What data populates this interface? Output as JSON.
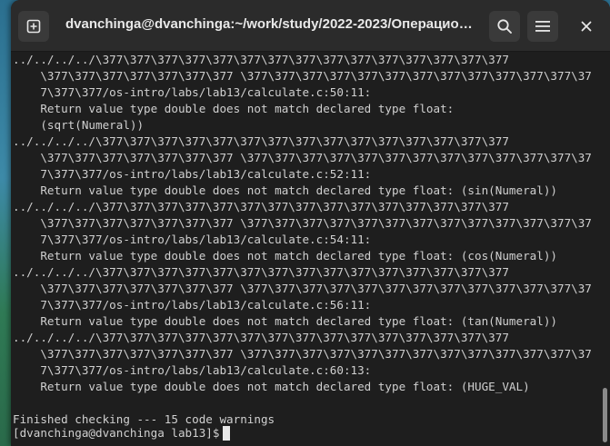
{
  "window": {
    "title": "dvanchinga@dvanchinga:~/work/study/2022-2023/Операционн…"
  },
  "header_buttons": {
    "new_tab_icon": "new-tab-plus-icon",
    "search_icon": "search-icon",
    "menu_icon": "hamburger-menu-icon",
    "close_icon": "close-icon"
  },
  "terminal": {
    "lines": [
      "../../../../\\377\\377\\377\\377\\377\\377\\377\\377\\377\\377\\377\\377\\377\\377\\377",
      "    \\377\\377\\377\\377\\377\\377\\377 \\377\\377\\377\\377\\377\\377\\377\\377\\377\\377\\377\\377\\37",
      "    7\\377\\377/os-intro/labs/lab13/calculate.c:50:11:",
      "    Return value type double does not match declared type float:",
      "    (sqrt(Numeral))",
      "../../../../\\377\\377\\377\\377\\377\\377\\377\\377\\377\\377\\377\\377\\377\\377\\377",
      "    \\377\\377\\377\\377\\377\\377\\377 \\377\\377\\377\\377\\377\\377\\377\\377\\377\\377\\377\\377\\37",
      "    7\\377\\377/os-intro/labs/lab13/calculate.c:52:11:",
      "    Return value type double does not match declared type float: (sin(Numeral))",
      "../../../../\\377\\377\\377\\377\\377\\377\\377\\377\\377\\377\\377\\377\\377\\377\\377",
      "    \\377\\377\\377\\377\\377\\377\\377 \\377\\377\\377\\377\\377\\377\\377\\377\\377\\377\\377\\377\\37",
      "    7\\377\\377/os-intro/labs/lab13/calculate.c:54:11:",
      "    Return value type double does not match declared type float: (cos(Numeral))",
      "../../../../\\377\\377\\377\\377\\377\\377\\377\\377\\377\\377\\377\\377\\377\\377\\377",
      "    \\377\\377\\377\\377\\377\\377\\377 \\377\\377\\377\\377\\377\\377\\377\\377\\377\\377\\377\\377\\37",
      "    7\\377\\377/os-intro/labs/lab13/calculate.c:56:11:",
      "    Return value type double does not match declared type float: (tan(Numeral))",
      "../../../../\\377\\377\\377\\377\\377\\377\\377\\377\\377\\377\\377\\377\\377\\377\\377",
      "    \\377\\377\\377\\377\\377\\377\\377 \\377\\377\\377\\377\\377\\377\\377\\377\\377\\377\\377\\377\\37",
      "    7\\377\\377/os-intro/labs/lab13/calculate.c:60:13:",
      "    Return value type double does not match declared type float: (HUGE_VAL)",
      "",
      "Finished checking --- 15 code warnings"
    ],
    "prompt": "[dvanchinga@dvanchinga lab13]$"
  }
}
